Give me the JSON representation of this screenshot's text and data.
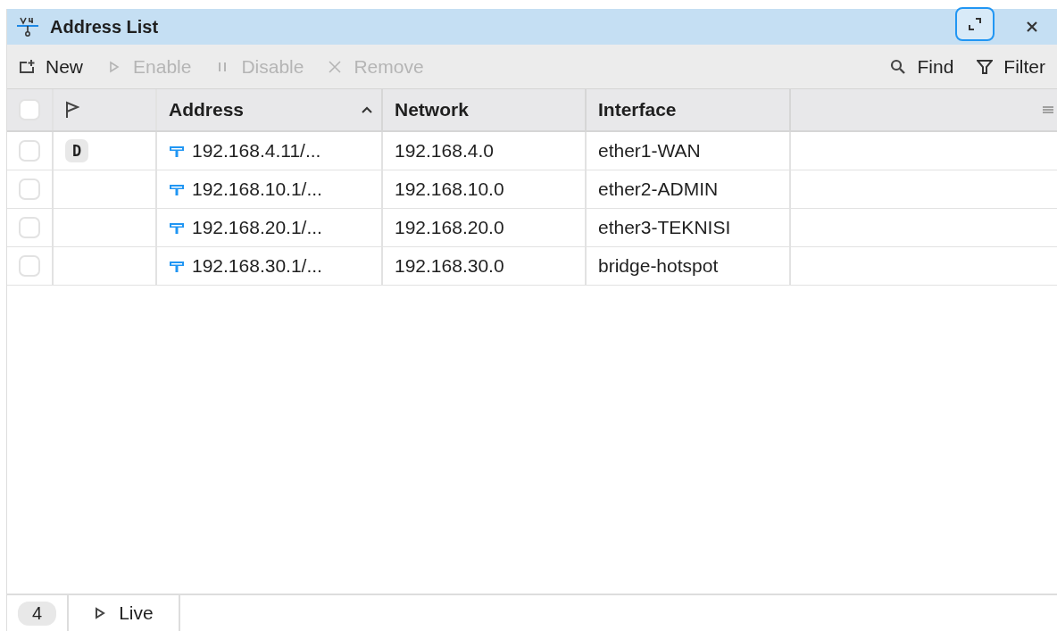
{
  "window": {
    "title": "Address List"
  },
  "toolbar": {
    "actions": [
      {
        "kind": "new",
        "label": "New",
        "disabled": false
      },
      {
        "kind": "enable",
        "label": "Enable",
        "disabled": true
      },
      {
        "kind": "disable",
        "label": "Disable",
        "disabled": true
      },
      {
        "kind": "remove",
        "label": "Remove",
        "disabled": true
      }
    ],
    "tools": [
      {
        "kind": "find",
        "label": "Find"
      },
      {
        "kind": "filter",
        "label": "Filter"
      }
    ]
  },
  "table": {
    "select_all": {
      "checked": false
    },
    "columns": [
      {
        "label": "Address",
        "sorted": true
      },
      {
        "label": "Network",
        "sorted": false
      },
      {
        "label": "Interface",
        "sorted": false
      }
    ],
    "rows": [
      {
        "checked": false,
        "flag": "D",
        "address": "192.168.4.11/...",
        "network": "192.168.4.0",
        "interface": "ether1-WAN"
      },
      {
        "checked": false,
        "address": "192.168.10.1/...",
        "network": "192.168.10.0",
        "interface": "ether2-ADMIN"
      },
      {
        "checked": false,
        "address": "192.168.20.1/...",
        "network": "192.168.20.0",
        "interface": "ether3-TEKNISI"
      },
      {
        "checked": false,
        "address": "192.168.30.1/...",
        "network": "192.168.30.0",
        "interface": "bridge-hotspot"
      }
    ]
  },
  "status_bar": {
    "count": "4",
    "live": "Live"
  }
}
